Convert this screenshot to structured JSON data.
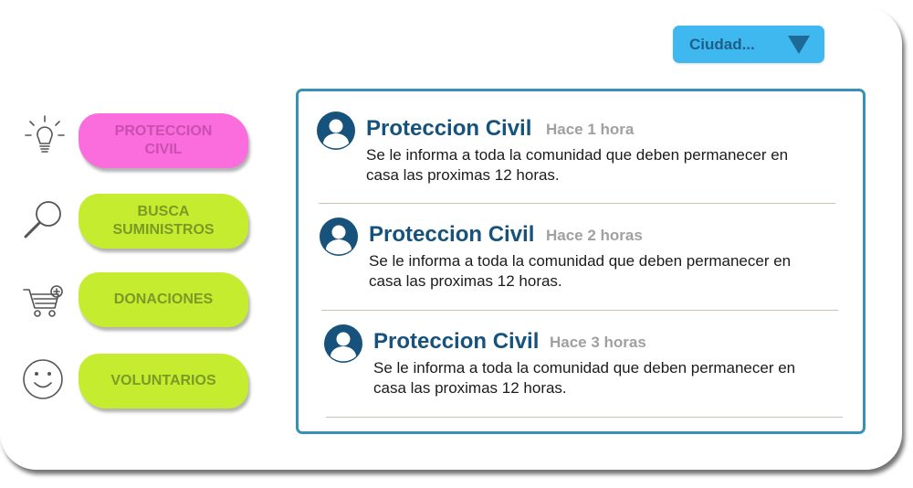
{
  "city_selector": {
    "label": "Ciudad...",
    "icon": "triangle-down-icon",
    "color": "#3fb7ef"
  },
  "menu": [
    {
      "label": "PROTECCION\nCIVIL",
      "icon": "lightbulb-icon",
      "color": "#fb6cdd",
      "active": true
    },
    {
      "label": "BUSCA\nSUMINISTROS",
      "icon": "magnifier-icon",
      "color": "#c6ec2f"
    },
    {
      "label": "DONACIONES",
      "icon": "cart-add-icon",
      "color": "#c6ec2f"
    },
    {
      "label": "VOLUNTARIOS",
      "icon": "smiley-icon",
      "color": "#c6ec2f"
    }
  ],
  "feed": {
    "posts": [
      {
        "author": "Proteccion Civil",
        "time": "Hace 1 hora",
        "message": "Se le informa a toda la comunidad que deben permanecer en casa las proximas 12 horas."
      },
      {
        "author": "Proteccion Civil",
        "time": "Hace 2 horas",
        "message": "Se le informa a toda la comunidad que deben permanecer en casa las proximas 12 horas."
      },
      {
        "author": "Proteccion Civil",
        "time": "Hace 3 horas",
        "message": "Se le informa a toda la comunidad que deben permanecer en casa las proximas 12 horas."
      }
    ]
  }
}
